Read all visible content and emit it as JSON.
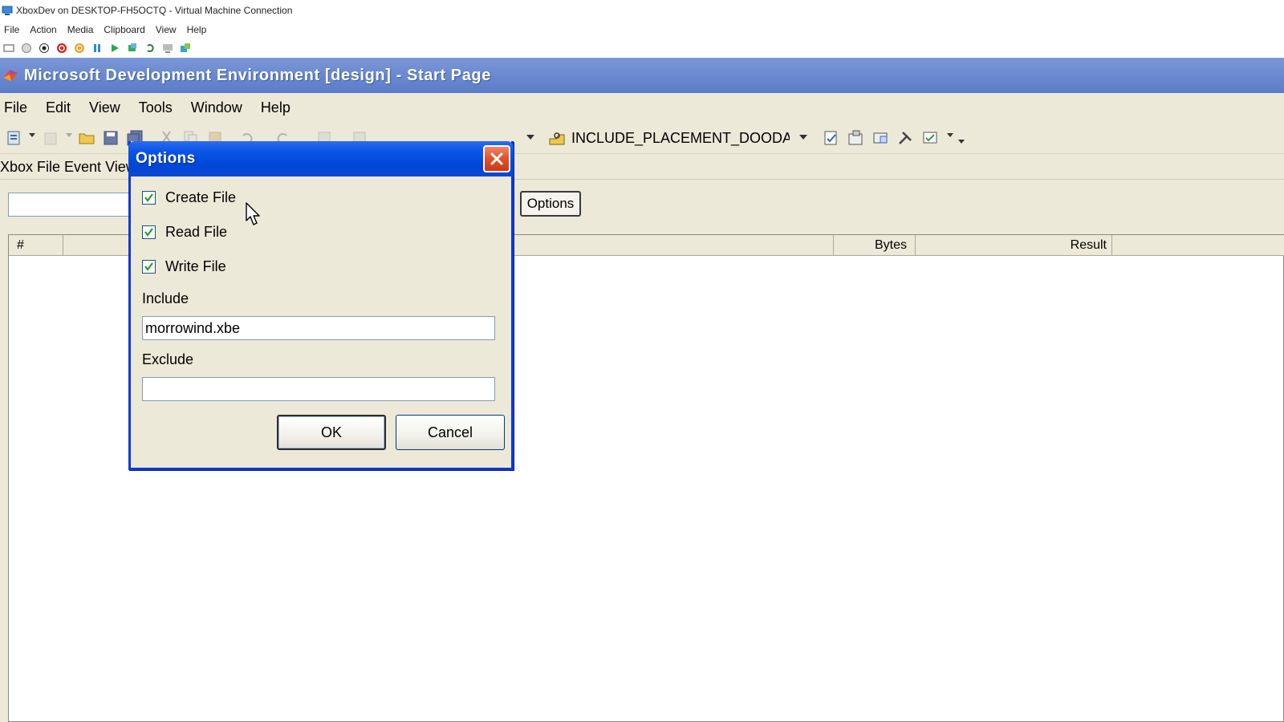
{
  "vm": {
    "title": "XboxDev on DESKTOP-FH5OCTQ - Virtual Machine Connection",
    "menu": [
      "File",
      "Action",
      "Media",
      "Clipboard",
      "View",
      "Help"
    ]
  },
  "ide": {
    "title": "Microsoft Development Environment [design] - Start Page",
    "menu": [
      "File",
      "Edit",
      "View",
      "Tools",
      "Window",
      "Help"
    ],
    "config_combo_value": "INCLUDE_PLACEMENT_DOODAD"
  },
  "document": {
    "tab_label": "Xbox File Event View",
    "options_button": "Options",
    "columns": {
      "num": "#",
      "bytes": "Bytes",
      "result": "Result"
    }
  },
  "dialog": {
    "title": "Options",
    "checkboxes": [
      {
        "label": "Create File",
        "checked": true
      },
      {
        "label": "Read File",
        "checked": true
      },
      {
        "label": "Write File",
        "checked": true
      }
    ],
    "include_label": "Include",
    "include_value": "morrowind.xbe",
    "exclude_label": "Exclude",
    "exclude_value": "",
    "ok_label": "OK",
    "cancel_label": "Cancel"
  },
  "colors": {
    "ide_title_bar": "#6a89d0",
    "dialog_title_bar": "#0a55e5",
    "close_button": "#e2532b",
    "window_face": "#ece9d8"
  }
}
